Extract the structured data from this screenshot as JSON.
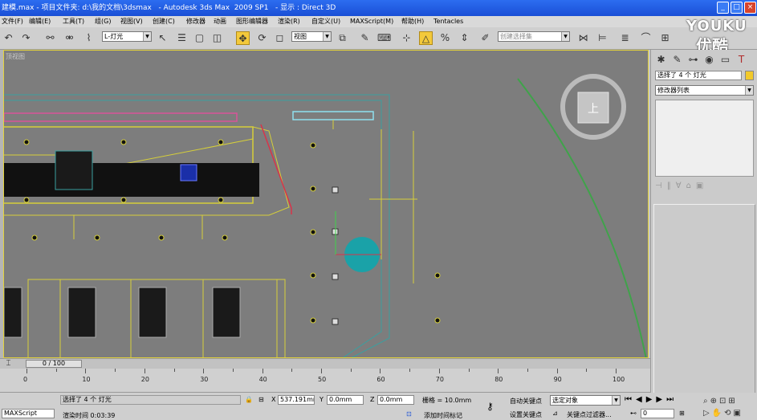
{
  "window": {
    "title": "建模.max - 项目文件夹: d:\\我的文档\\3dsmax   - Autodesk 3ds Max  2009 SP1   - 显示 : Direct 3D",
    "btn_min": "_",
    "btn_max": "□",
    "btn_close": "×"
  },
  "menu": [
    "文件(F)",
    "编辑(E)",
    "工具(T)",
    "组(G)",
    "视图(V)",
    "创建(C)",
    "修改器",
    "动画",
    "图形编辑器",
    "渲染(R)",
    "自定义(U)",
    "MAXScript(M)",
    "帮助(H)",
    "Tentacles"
  ],
  "toolbar": {
    "selection_filter": "L-灯光",
    "ref_coord": "视图",
    "named_selection": "创建选择集"
  },
  "viewport": {
    "label": "顶视图",
    "viewcube_face": "上"
  },
  "command_panel": {
    "selected_field": "选择了 4 个 灯光",
    "modifier_list": "修改器列表"
  },
  "timeline": {
    "frame_indicator": "0 / 100",
    "ticks": [
      "0",
      "10",
      "20",
      "30",
      "40",
      "50",
      "60",
      "70",
      "80",
      "90",
      "100"
    ]
  },
  "status": {
    "selection": "选择了 4 个 灯光",
    "render_time": "渲染时间  0:03:39",
    "x_val": "537.191mm",
    "y_val": "0.0mm",
    "z_val": "0.0mm",
    "grid": "栅格 = 10.0mm",
    "add_time_tag": "添加时间标记",
    "auto_key": "自动关键点",
    "set_key": "设置关键点",
    "key_mode": "选定对象",
    "key_filters": "关键点过滤器...",
    "frame": "0",
    "maxscript": "MAXScript"
  },
  "watermark": {
    "text": "YOUKU",
    "sub": "优酷"
  },
  "colors": {
    "viewport_bg": "#7d7d7d",
    "active_tool": "#f3c93b",
    "selected_light": "#1aa2a8"
  }
}
